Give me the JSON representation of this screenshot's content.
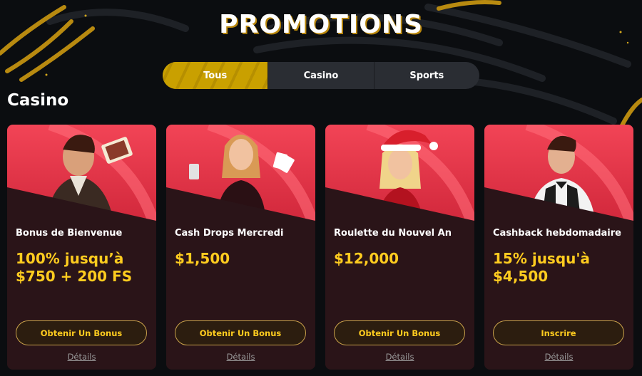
{
  "header": {
    "title": "PROMOTIONS"
  },
  "tabs": [
    {
      "label": "Tous",
      "active": true
    },
    {
      "label": "Casino",
      "active": false
    },
    {
      "label": "Sports",
      "active": false
    }
  ],
  "section": {
    "title": "Casino"
  },
  "cards": [
    {
      "name": "Bonus de Bienvenue",
      "amount": "100% jusqu’à $750 + 200 FS",
      "button": "Obtenir Un Bonus",
      "details": "Détails"
    },
    {
      "name": "Cash Drops Mercredi",
      "amount": "$1,500",
      "button": "Obtenir Un Bonus",
      "details": "Détails"
    },
    {
      "name": "Roulette du Nouvel An",
      "amount": "$12,000",
      "button": "Obtenir Un Bonus",
      "details": "Détails"
    },
    {
      "name": "Cashback hebdomadaire",
      "amount": "15% jusqu'à $4,500",
      "button": "Inscrire",
      "details": "Détails"
    }
  ],
  "colors": {
    "background": "#0b0d10",
    "accent_gold": "#ffcc1f",
    "card_top_red": "#e8384a",
    "card_bottom": "#2a1418",
    "tab_inactive": "#2a2d33"
  }
}
